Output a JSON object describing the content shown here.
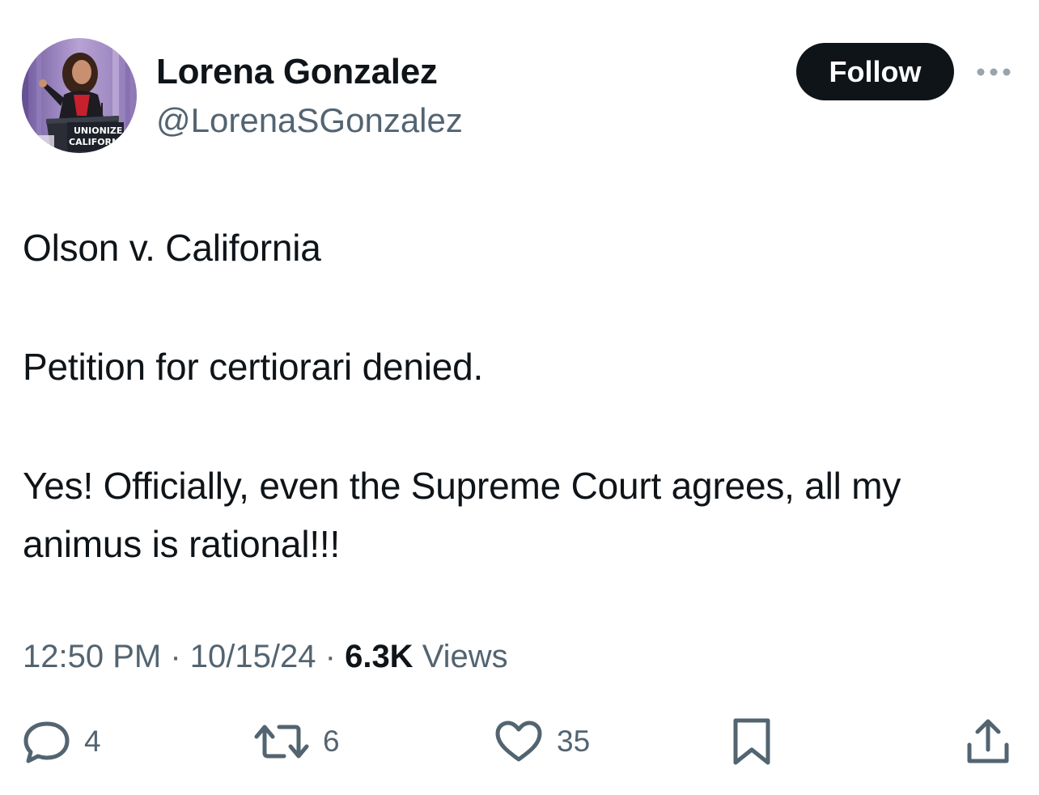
{
  "author": {
    "name": "Lorena Gonzalez",
    "handle": "@LorenaSGonzalez",
    "avatar_sign_text": [
      "UNIONIZE",
      "CALIFORNIA"
    ]
  },
  "header": {
    "follow_label": "Follow",
    "more_icon": "more-dots-icon"
  },
  "tweet": {
    "lines": [
      "Olson v. California",
      "Petition for certiorari denied.",
      "Yes! Officially, even the Supreme Court agrees, all my animus is rational!!!"
    ]
  },
  "meta": {
    "time": "12:50 PM",
    "separator": "·",
    "date": "10/15/24",
    "views_count": "6.3K",
    "views_label": "Views"
  },
  "actions": {
    "replies": {
      "icon": "reply-icon",
      "count": "4"
    },
    "reposts": {
      "icon": "repost-icon",
      "count": "6"
    },
    "likes": {
      "icon": "heart-icon",
      "count": "35"
    },
    "bookmark": {
      "icon": "bookmark-icon"
    },
    "share": {
      "icon": "share-icon"
    }
  },
  "colors": {
    "text_primary": "#0f1419",
    "text_secondary": "#536471",
    "follow_bg": "#0f1419",
    "follow_text": "#ffffff",
    "more_dots": "#9aa4ad"
  }
}
